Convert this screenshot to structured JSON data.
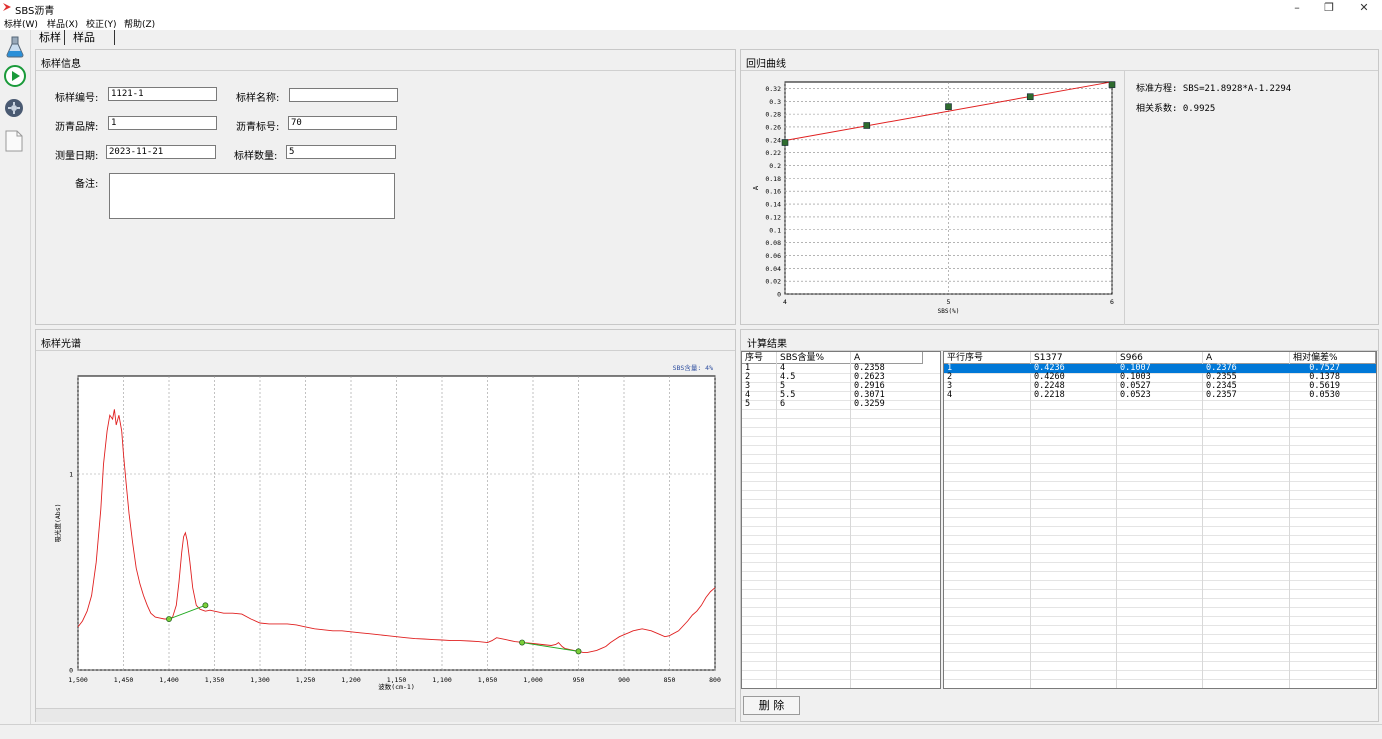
{
  "window": {
    "title": "SBS沥青",
    "minimize": "–",
    "restore": "❐",
    "close": "✕"
  },
  "menu": [
    "标样(W)",
    "样品(X)",
    "校正(Y)",
    "帮助(Z)"
  ],
  "toolbar": [
    "flask-icon",
    "play-icon",
    "settings-icon",
    "document-icon"
  ],
  "tabs": [
    "标样",
    "样品"
  ],
  "standard_info": {
    "title": "标样信息",
    "id_label": "标样编号:",
    "id_value": "1121-1",
    "name_label": "标样名称:",
    "name_value": "",
    "brand_label": "沥青品牌:",
    "brand_value": "1",
    "grade_label": "沥青标号:",
    "grade_value": "70",
    "date_label": "测量日期:",
    "date_value": "2023-11-21",
    "count_label": "标样数量:",
    "count_value": "5",
    "notes_label": "备注:",
    "notes_value": ""
  },
  "regression": {
    "title": "回归曲线",
    "equation": "标准方程: SBS=21.8928*A-1.2294",
    "correlation": "相关系数: 0.9925"
  },
  "spectrum": {
    "title": "标样光谱",
    "legend": "SBS含量: 4%"
  },
  "results": {
    "title": "计算结果",
    "left_headers": [
      "序号",
      "SBS含量%",
      "A"
    ],
    "left_rows": [
      [
        "1",
        "4",
        "0.2358"
      ],
      [
        "2",
        "4.5",
        "0.2623"
      ],
      [
        "3",
        "5",
        "0.2916"
      ],
      [
        "4",
        "5.5",
        "0.3071"
      ],
      [
        "5",
        "6",
        "0.3259"
      ]
    ],
    "right_headers": [
      "平行序号",
      "S1377",
      "S966",
      "A",
      "相对偏差%"
    ],
    "right_rows": [
      [
        "1",
        "0.4236",
        "0.1007",
        "0.2376",
        "0.7527"
      ],
      [
        "2",
        "0.4260",
        "0.1003",
        "0.2355",
        "0.1378"
      ],
      [
        "3",
        "0.2248",
        "0.0527",
        "0.2345",
        "0.5619"
      ],
      [
        "4",
        "0.2218",
        "0.0523",
        "0.2357",
        "0.0530"
      ]
    ],
    "selected_row": 0,
    "delete_label": "删 除"
  },
  "colors": {
    "selection": "#0078d7",
    "spectrum_line": "#e02020",
    "regression_line": "#e02020",
    "marker": "#2e6b2e",
    "baseline": "#22aa22",
    "legend_text": "#3050a0"
  },
  "chart_data": [
    {
      "type": "scatter",
      "title": "",
      "xlabel": "SBS(%)",
      "ylabel": "A",
      "xlim": [
        4,
        6
      ],
      "ylim": [
        0,
        0.33
      ],
      "x_ticks": [
        "4",
        "5",
        "6"
      ],
      "y_ticks": [
        "0",
        "0.02",
        "0.04",
        "0.06",
        "0.08",
        "0.1",
        "0.12",
        "0.14",
        "0.16",
        "0.18",
        "0.2",
        "0.22",
        "0.24",
        "0.26",
        "0.28",
        "0.3",
        "0.32"
      ],
      "grid": true,
      "points": {
        "x": [
          4,
          4.5,
          5,
          5.5,
          6
        ],
        "y": [
          0.2358,
          0.2623,
          0.2916,
          0.3071,
          0.3259
        ]
      },
      "fit_line": {
        "x": [
          4,
          6
        ],
        "y": [
          0.2389,
          0.3303
        ]
      }
    },
    {
      "type": "line",
      "title": "",
      "xlabel": "波数(cm-1)",
      "ylabel": "吸光度(Abs)",
      "xlim": [
        1500,
        800
      ],
      "ylim": [
        0,
        1.5
      ],
      "x_ticks": [
        "1,500",
        "1,450",
        "1,400",
        "1,350",
        "1,300",
        "1,250",
        "1,200",
        "1,150",
        "1,100",
        "1,050",
        "1,000",
        "950",
        "900",
        "850",
        "800"
      ],
      "y_ticks": [
        "0",
        "1"
      ],
      "grid": true,
      "series": [
        {
          "x": [
            1500,
            1495,
            1490,
            1485,
            1480,
            1475,
            1472,
            1468,
            1465,
            1462,
            1460,
            1458,
            1455,
            1452,
            1450,
            1447,
            1444,
            1440,
            1436,
            1432,
            1428,
            1424,
            1420,
            1415,
            1410,
            1405,
            1400,
            1396,
            1392,
            1389,
            1386,
            1384,
            1382,
            1380,
            1377,
            1374,
            1370,
            1366,
            1360,
            1355,
            1350,
            1340,
            1330,
            1320,
            1310,
            1300,
            1290,
            1280,
            1270,
            1260,
            1250,
            1240,
            1230,
            1220,
            1210,
            1200,
            1190,
            1180,
            1170,
            1160,
            1150,
            1140,
            1130,
            1120,
            1110,
            1100,
            1090,
            1080,
            1070,
            1060,
            1050,
            1045,
            1040,
            1030,
            1020,
            1010,
            1000,
            990,
            980,
            975,
            972,
            968,
            965,
            960,
            955,
            950,
            945,
            940,
            935,
            930,
            925,
            920,
            915,
            910,
            905,
            900,
            895,
            890,
            880,
            870,
            860,
            855,
            850,
            840,
            830,
            825,
            820,
            815,
            810,
            805,
            800
          ],
          "y": [
            0.22,
            0.25,
            0.3,
            0.38,
            0.55,
            0.82,
            1.05,
            1.22,
            1.3,
            1.28,
            1.33,
            1.25,
            1.3,
            1.22,
            1.1,
            0.95,
            0.8,
            0.65,
            0.52,
            0.44,
            0.38,
            0.33,
            0.29,
            0.27,
            0.265,
            0.26,
            0.26,
            0.27,
            0.33,
            0.45,
            0.6,
            0.68,
            0.7,
            0.66,
            0.55,
            0.42,
            0.33,
            0.31,
            0.3,
            0.305,
            0.3,
            0.29,
            0.29,
            0.285,
            0.26,
            0.24,
            0.235,
            0.235,
            0.235,
            0.23,
            0.22,
            0.21,
            0.205,
            0.2,
            0.2,
            0.195,
            0.19,
            0.185,
            0.18,
            0.175,
            0.17,
            0.165,
            0.16,
            0.158,
            0.155,
            0.153,
            0.15,
            0.15,
            0.148,
            0.145,
            0.14,
            0.15,
            0.165,
            0.155,
            0.145,
            0.14,
            0.135,
            0.13,
            0.125,
            0.13,
            0.14,
            0.12,
            0.11,
            0.105,
            0.1,
            0.095,
            0.09,
            0.09,
            0.095,
            0.1,
            0.11,
            0.12,
            0.14,
            0.155,
            0.17,
            0.18,
            0.19,
            0.2,
            0.21,
            0.2,
            0.18,
            0.17,
            0.175,
            0.2,
            0.25,
            0.28,
            0.3,
            0.33,
            0.37,
            0.4,
            0.42
          ]
        }
      ],
      "baselines": [
        {
          "x": [
            1400,
            1360
          ],
          "y": [
            0.26,
            0.33
          ]
        },
        {
          "x": [
            1012,
            950
          ],
          "y": [
            0.14,
            0.095
          ]
        }
      ]
    }
  ],
  "status_bar": ""
}
